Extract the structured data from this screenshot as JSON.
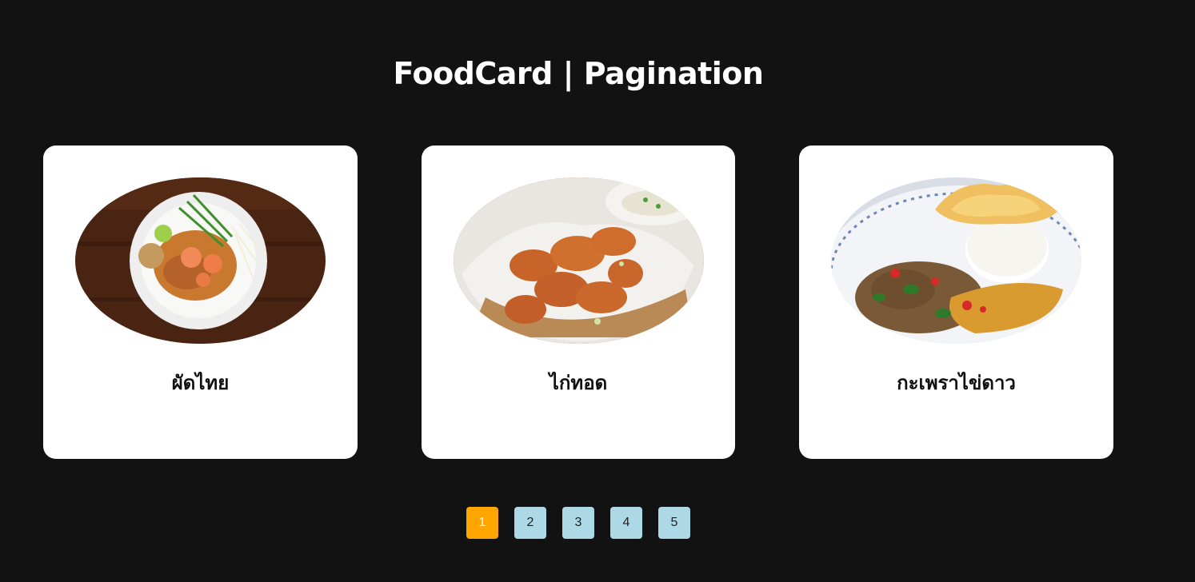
{
  "page": {
    "title": "FoodCard | Pagination"
  },
  "cards": [
    {
      "name": "ผัดไทย",
      "image": "pad-thai-photo"
    },
    {
      "name": "ไก่ทอด",
      "image": "fried-chicken-photo"
    },
    {
      "name": "กะเพราไข่ดาว",
      "image": "basil-pork-fried-egg-photo"
    }
  ],
  "pagination": {
    "pages": [
      "1",
      "2",
      "3",
      "4",
      "5"
    ],
    "current": "1"
  },
  "colors": {
    "background": "#121212",
    "card": "#ffffff",
    "active_page": "#ffa500",
    "page_button": "#add8e6"
  }
}
